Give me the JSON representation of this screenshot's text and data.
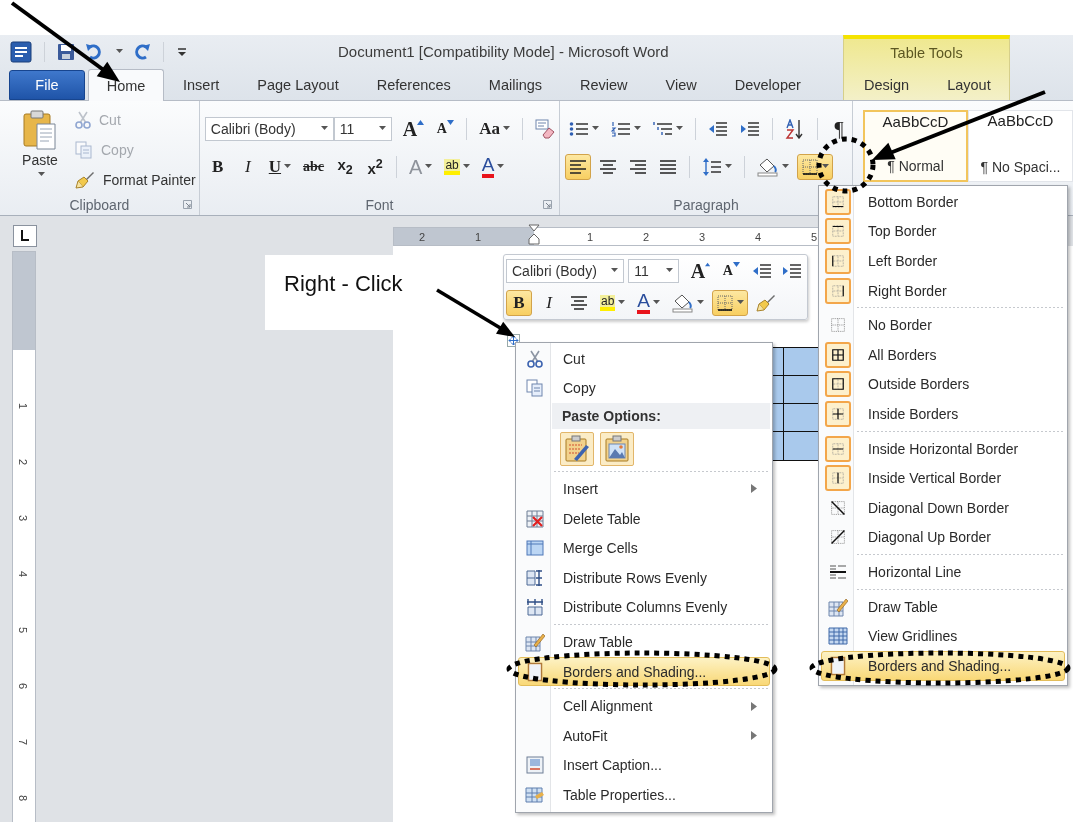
{
  "title_bar": {
    "title": "Document1 [Compatibility Mode] - Microsoft Word",
    "context_header": "Table Tools"
  },
  "tabs": [
    {
      "label": "File",
      "kind": "file",
      "selected": false
    },
    {
      "label": "Home",
      "kind": "main",
      "selected": true
    },
    {
      "label": "Insert",
      "kind": "main",
      "selected": false
    },
    {
      "label": "Page Layout",
      "kind": "main",
      "selected": false
    },
    {
      "label": "References",
      "kind": "main",
      "selected": false
    },
    {
      "label": "Mailings",
      "kind": "main",
      "selected": false
    },
    {
      "label": "Review",
      "kind": "main",
      "selected": false
    },
    {
      "label": "View",
      "kind": "main",
      "selected": false
    },
    {
      "label": "Developer",
      "kind": "main",
      "selected": false
    },
    {
      "label": "Design",
      "kind": "context",
      "selected": false
    },
    {
      "label": "Layout",
      "kind": "context",
      "selected": false
    }
  ],
  "clipboard": {
    "label": "Clipboard",
    "paste": "Paste",
    "actions": [
      {
        "kind": "cut",
        "label": "Cut",
        "disabled": true
      },
      {
        "kind": "copy",
        "label": "Copy",
        "disabled": true
      },
      {
        "kind": "painter",
        "label": "Format Painter",
        "disabled": false
      }
    ]
  },
  "font": {
    "label": "Font",
    "font_name": "Calibri (Body)",
    "font_size": "11",
    "row1": [
      {
        "kind": "grow-font",
        "label": "A"
      },
      {
        "kind": "shrink-font",
        "label": "A"
      },
      {
        "kind": "separator"
      },
      {
        "kind": "change-case",
        "label": "Aa",
        "caret": true
      },
      {
        "kind": "separator"
      },
      {
        "kind": "clear-formatting"
      }
    ],
    "row2": [
      {
        "kind": "bold",
        "label": "B"
      },
      {
        "kind": "italic",
        "label": "I"
      },
      {
        "kind": "underline",
        "label": "U",
        "caret": true
      },
      {
        "kind": "strikethrough",
        "label": "abc"
      },
      {
        "kind": "subscript",
        "label": "x$_{2}$"
      },
      {
        "kind": "superscript",
        "label": "x$^{2}$"
      },
      {
        "kind": "separator"
      },
      {
        "kind": "text-effects",
        "label": "A",
        "caret": true
      },
      {
        "kind": "highlight",
        "label": "ab",
        "caret": true
      },
      {
        "kind": "font-color",
        "label": "A",
        "caret": true
      }
    ]
  },
  "paragraph": {
    "label": "Paragraph",
    "row1": [
      {
        "kind": "bullets",
        "caret": true
      },
      {
        "kind": "numbering",
        "caret": true
      },
      {
        "kind": "multilevel",
        "caret": true
      },
      {
        "kind": "separator"
      },
      {
        "kind": "decrease-indent"
      },
      {
        "kind": "increase-indent"
      },
      {
        "kind": "separator"
      },
      {
        "kind": "sort"
      },
      {
        "kind": "separator"
      },
      {
        "kind": "show-marks",
        "label": "¶"
      }
    ],
    "row2": [
      {
        "kind": "align-left",
        "selected": true
      },
      {
        "kind": "align-center",
        "selected": false
      },
      {
        "kind": "align-right",
        "selected": false
      },
      {
        "kind": "justify",
        "selected": false
      },
      {
        "kind": "separator"
      },
      {
        "kind": "line-spacing",
        "caret": true
      },
      {
        "kind": "separator"
      },
      {
        "kind": "shading",
        "caret": true
      },
      {
        "kind": "borders",
        "caret": true,
        "selected": true
      }
    ]
  },
  "styles": [
    {
      "preview": "AaBbCcD",
      "name": "¶ Normal",
      "selected": true
    },
    {
      "preview": "AaBbCcD",
      "name": "¶ No Spaci...",
      "selected": false
    }
  ],
  "ruler": {
    "horizontal": [
      "2",
      "1",
      "1",
      "2",
      "3",
      "4",
      "5"
    ],
    "vertical": [
      "1",
      "2",
      "3",
      "4",
      "5",
      "6",
      "7",
      "8"
    ]
  },
  "callout": "Right - Click",
  "mini_toolbar": {
    "font_name": "Calibri (Body)",
    "font_size": "11",
    "row1": [
      {
        "kind": "grow-font",
        "label": "A"
      },
      {
        "kind": "shrink-font",
        "label": "A"
      },
      {
        "kind": "decrease-indent"
      },
      {
        "kind": "increase-indent"
      }
    ],
    "row2": [
      {
        "kind": "bold",
        "label": "B",
        "selected": true
      },
      {
        "kind": "italic",
        "label": "I",
        "selected": false
      },
      {
        "kind": "align-center"
      },
      {
        "kind": "highlight",
        "label": "ab",
        "caret": true
      },
      {
        "kind": "font-color",
        "label": "A",
        "caret": true
      },
      {
        "kind": "shading",
        "caret": true
      },
      {
        "kind": "borders",
        "caret": true,
        "selected": true
      },
      {
        "kind": "painter"
      }
    ]
  },
  "context_menu": [
    {
      "kind": "item",
      "label": "Cut",
      "submenu": false,
      "separator_before": false,
      "selected": false
    },
    {
      "kind": "item",
      "label": "Copy",
      "submenu": false,
      "separator_before": false,
      "selected": false
    },
    {
      "kind": "heading",
      "label": "Paste Options:",
      "submenu": false,
      "separator_before": false,
      "selected": false
    },
    {
      "kind": "paste-options",
      "submenu": false,
      "separator_before": false,
      "selected": false
    },
    {
      "kind": "item",
      "label": "Insert",
      "submenu": true,
      "separator_before": true,
      "selected": false
    },
    {
      "kind": "item",
      "label": "Delete Table",
      "submenu": false,
      "separator_before": false,
      "selected": false
    },
    {
      "kind": "item",
      "label": "Merge Cells",
      "submenu": false,
      "separator_before": false,
      "selected": false
    },
    {
      "kind": "item",
      "label": "Distribute Rows Evenly",
      "submenu": false,
      "separator_before": false,
      "selected": false
    },
    {
      "kind": "item",
      "label": "Distribute Columns Evenly",
      "submenu": false,
      "separator_before": false,
      "selected": false
    },
    {
      "kind": "item",
      "label": "Draw Table",
      "submenu": false,
      "separator_before": true,
      "selected": false
    },
    {
      "kind": "item",
      "label": "Borders and Shading...",
      "submenu": false,
      "separator_before": false,
      "selected": true
    },
    {
      "kind": "item",
      "label": "Cell Alignment",
      "submenu": true,
      "separator_before": true,
      "selected": false
    },
    {
      "kind": "item",
      "label": "AutoFit",
      "submenu": true,
      "separator_before": false,
      "selected": false
    },
    {
      "kind": "item",
      "label": "Insert Caption...",
      "submenu": false,
      "separator_before": false,
      "selected": false
    },
    {
      "kind": "item",
      "label": "Table Properties...",
      "submenu": false,
      "separator_before": false,
      "selected": false
    }
  ],
  "borders_menu": [
    {
      "label": "Bottom Border",
      "on": true,
      "separator_before": false,
      "selected": false
    },
    {
      "label": "Top Border",
      "on": true,
      "separator_before": false,
      "selected": false
    },
    {
      "label": "Left Border",
      "on": true,
      "separator_before": false,
      "selected": false
    },
    {
      "label": "Right Border",
      "on": true,
      "separator_before": false,
      "selected": false
    },
    {
      "label": "No Border",
      "on": false,
      "separator_before": true,
      "selected": false
    },
    {
      "label": "All Borders",
      "on": true,
      "separator_before": false,
      "selected": false
    },
    {
      "label": "Outside Borders",
      "on": true,
      "separator_before": false,
      "selected": false
    },
    {
      "label": "Inside Borders",
      "on": true,
      "separator_before": false,
      "selected": false
    },
    {
      "label": "Inside Horizontal Border",
      "on": true,
      "separator_before": true,
      "selected": false
    },
    {
      "label": "Inside Vertical Border",
      "on": true,
      "separator_before": false,
      "selected": false
    },
    {
      "label": "Diagonal Down Border",
      "on": false,
      "separator_before": false,
      "selected": false
    },
    {
      "label": "Diagonal Up Border",
      "on": false,
      "separator_before": false,
      "selected": false
    },
    {
      "label": "Horizontal Line",
      "on": false,
      "separator_before": true,
      "selected": false
    },
    {
      "label": "Draw Table",
      "on": false,
      "separator_before": true,
      "selected": false
    },
    {
      "label": "View Gridlines",
      "on": false,
      "separator_before": false,
      "selected": false
    },
    {
      "label": "Borders and Shading...",
      "on": false,
      "separator_before": false,
      "selected": true
    }
  ]
}
